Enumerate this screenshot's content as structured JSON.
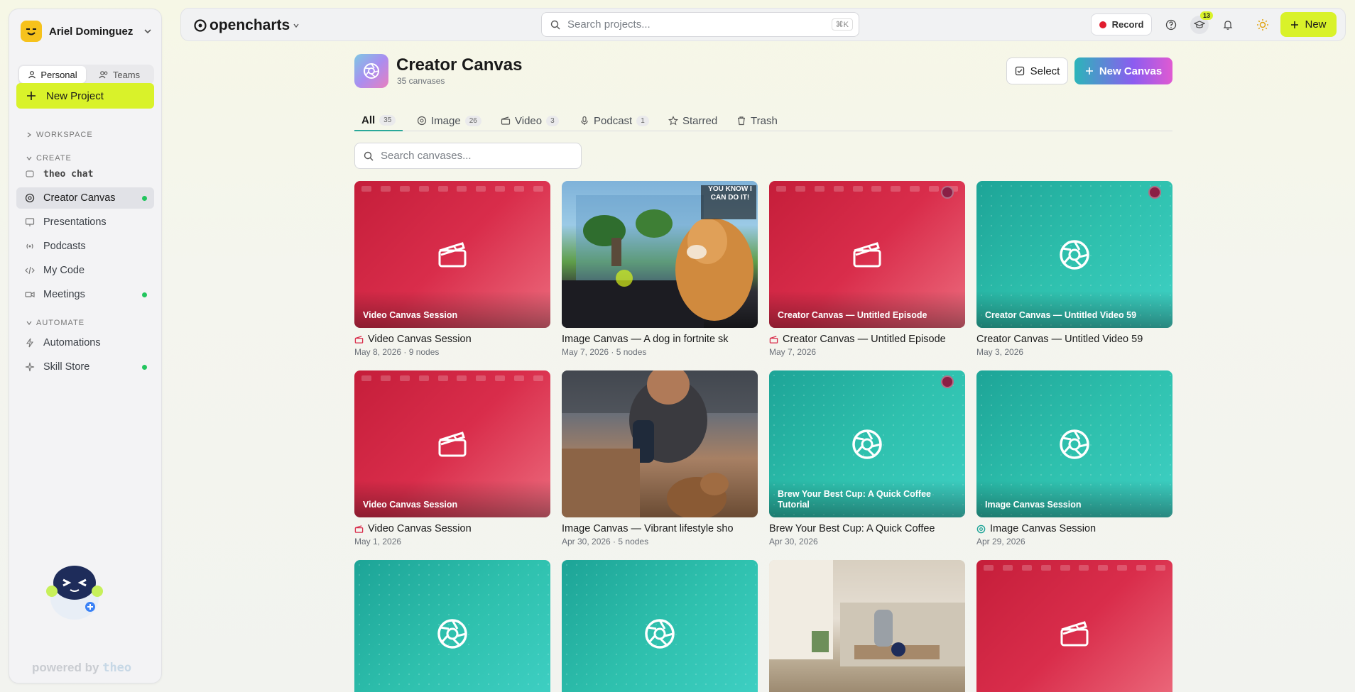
{
  "user": {
    "name": "Ariel Dominguez"
  },
  "mode_tabs": {
    "personal": "Personal",
    "teams": "Teams"
  },
  "new_project": "New Project",
  "sections": {
    "workspace": "WORKSPACE",
    "create": "CREATE",
    "automate": "AUTOMATE"
  },
  "nav": {
    "theo_chat": "theo chat",
    "creator_canvas": "Creator Canvas",
    "presentations": "Presentations",
    "podcasts": "Podcasts",
    "my_code": "My Code",
    "meetings": "Meetings",
    "automations": "Automations",
    "skill_store": "Skill Store"
  },
  "powered_by": {
    "prefix": "powered by",
    "brand": "theo"
  },
  "topbar": {
    "logo": "opencharts",
    "search_placeholder": "Search projects...",
    "search_shortcut": "⌘K",
    "record": "Record",
    "learn_badge": "13",
    "new": "New"
  },
  "page": {
    "title": "Creator Canvas",
    "subtitle": "35 canvases",
    "select": "Select",
    "new_canvas": "New Canvas",
    "canvas_search_placeholder": "Search canvases..."
  },
  "tabs": [
    {
      "label": "All",
      "count": "35"
    },
    {
      "label": "Image",
      "count": "26"
    },
    {
      "label": "Video",
      "count": "3"
    },
    {
      "label": "Podcast",
      "count": "1"
    },
    {
      "label": "Starred",
      "count": ""
    },
    {
      "label": "Trash",
      "count": ""
    }
  ],
  "cards": [
    {
      "caption": "Video Canvas Session",
      "title": "Video Canvas Session",
      "meta": "May 8, 2026 · 9 nodes",
      "style": "red"
    },
    {
      "caption": "",
      "title": "Image Canvas — A dog in fortnite sk",
      "meta": "May 7, 2026 · 5 nodes",
      "style": "photo-game",
      "overlay_text": "YOU KNOW I CAN DO IT!"
    },
    {
      "caption": "Creator Canvas — Untitled Episode",
      "title": "Creator Canvas — Untitled Episode",
      "meta": "May 7, 2026",
      "style": "red"
    },
    {
      "caption": "Creator Canvas — Untitled Video 59",
      "title": "Creator Canvas — Untitled Video 59",
      "meta": "May 3, 2026",
      "style": "teal"
    },
    {
      "caption": "Video Canvas Session",
      "title": "Video Canvas Session",
      "meta": "May 1, 2026",
      "style": "red"
    },
    {
      "caption": "",
      "title": "Image Canvas — Vibrant lifestyle sho",
      "meta": "Apr 30, 2026 · 5 nodes",
      "style": "photo-gym"
    },
    {
      "caption": "Brew Your Best Cup: A Quick Coffee Tutorial",
      "title": "Brew Your Best Cup: A Quick Coffee",
      "meta": "Apr 30, 2026",
      "style": "teal"
    },
    {
      "caption": "Image Canvas Session",
      "title": "Image Canvas Session",
      "meta": "Apr 29, 2026",
      "style": "teal"
    },
    {
      "caption": "",
      "title": "",
      "meta": "",
      "style": "teal"
    },
    {
      "caption": "",
      "title": "",
      "meta": "",
      "style": "teal"
    },
    {
      "caption": "",
      "title": "",
      "meta": "",
      "style": "photo-room"
    },
    {
      "caption": "",
      "title": "",
      "meta": "",
      "style": "red"
    }
  ],
  "colors": {
    "accent_lime": "#d9f22a",
    "video_red": "#d92d4b",
    "image_teal": "#2ec0ad",
    "active_green": "#22c55e"
  }
}
